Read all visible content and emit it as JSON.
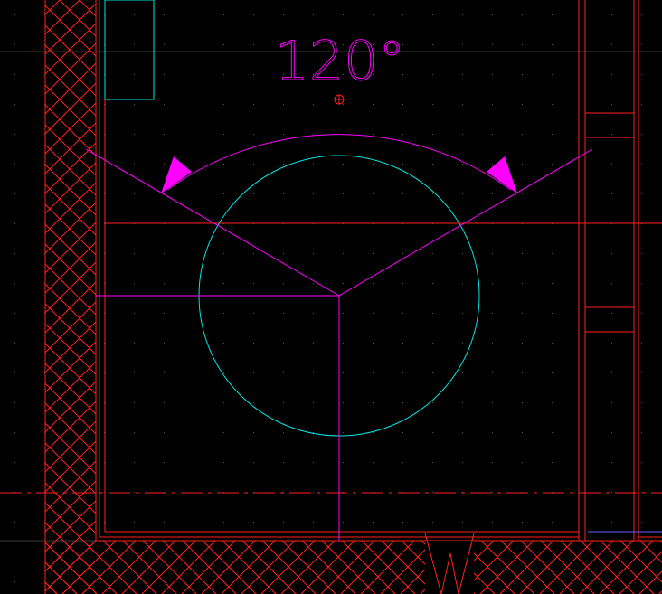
{
  "drawing": {
    "angle_label": "120°",
    "dimension_angle_deg": 120,
    "colors": {
      "background": "#000000",
      "wall": "#ff2020",
      "dimension": "#ff00ff",
      "circle": "#00e5e5",
      "grid": "#3a3a3a"
    },
    "icons": {
      "center_marker": "crosshair-circle-icon",
      "arrowheads": "triangle-arrow-icon"
    }
  }
}
